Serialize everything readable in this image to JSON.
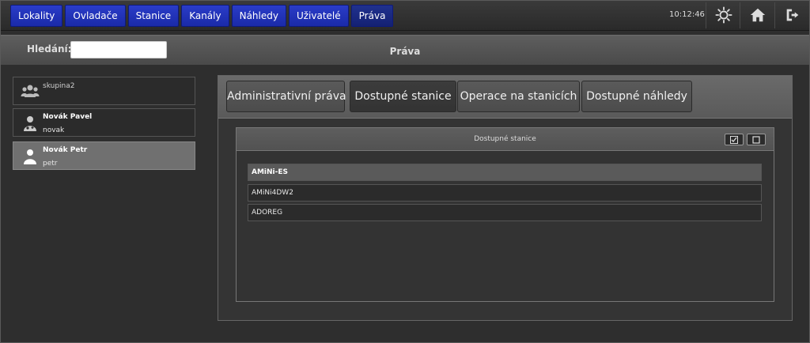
{
  "nav": {
    "items": [
      "Lokality",
      "Ovladače",
      "Stanice",
      "Kanály",
      "Náhledy",
      "Uživatelé",
      "Práva"
    ]
  },
  "header": {
    "clock": "10:12:46",
    "icons": [
      "settings-icon",
      "home-icon",
      "logout-icon"
    ]
  },
  "search": {
    "label": "Hledání:",
    "value": "",
    "placeholder": ""
  },
  "page": {
    "title": "Práva"
  },
  "users": [
    {
      "name": "skupina2",
      "login": "",
      "type": "group",
      "icon": "group-icon"
    },
    {
      "name": "Novák Pavel",
      "login": "novak",
      "type": "user",
      "icon": "doctor-user-icon"
    },
    {
      "name": "Novák Petr",
      "login": "petr",
      "type": "user",
      "icon": "user-icon",
      "selected": true
    }
  ],
  "tabs": [
    "Administrativní práva",
    "Dostupné stanice",
    "Operace na stanicích",
    "Dostupné náhledy"
  ],
  "active_tab": "Dostupné stanice",
  "stations_panel": {
    "title": "Dostupné stanice",
    "buttons": [
      "check-all-icon",
      "uncheck-all-icon"
    ],
    "items": [
      {
        "name": "AMiNi-ES",
        "highlight": true
      },
      {
        "name": "AMiNi4DW2",
        "highlight": false
      },
      {
        "name": "ADOREG",
        "highlight": false
      }
    ]
  },
  "colors": {
    "nav_accent": "#1a2aa8",
    "background": "#2e2e2e",
    "selected_item": "#707070"
  }
}
